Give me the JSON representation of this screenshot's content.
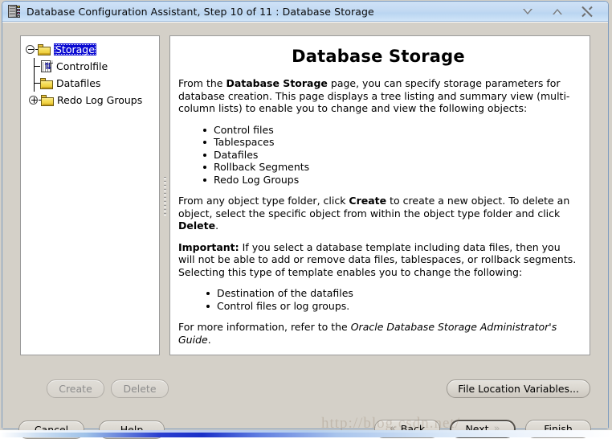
{
  "window": {
    "title": "Database Configuration Assistant, Step 10 of 11 : Database Storage",
    "icon": "database-icon",
    "controls": {
      "minimize": "minimize-icon",
      "maximize": "maximize-icon",
      "close": "close-icon"
    }
  },
  "tree": {
    "nodes": [
      {
        "label": "Storage",
        "icon": "folder-icon",
        "expanded": true,
        "selected": true,
        "level": 0
      },
      {
        "label": "Controlfile",
        "icon": "controlfile-icon",
        "expanded": null,
        "selected": false,
        "level": 1
      },
      {
        "label": "Datafiles",
        "icon": "folder-icon",
        "expanded": null,
        "selected": false,
        "level": 1
      },
      {
        "label": "Redo Log Groups",
        "icon": "folder-icon",
        "expanded": false,
        "selected": false,
        "level": 1
      }
    ]
  },
  "content": {
    "title": "Database Storage",
    "para1": {
      "before": "From the ",
      "bold": "Database Storage",
      "after": " page, you can specify storage parameters for database creation. This page displays a tree listing and summary view (multi-column lists) to enable you to change and view the following objects:"
    },
    "objects": [
      "Control files",
      "Tablespaces",
      "Datafiles",
      "Rollback Segments",
      "Redo Log Groups"
    ],
    "para2": {
      "t1": "From any object type folder, click ",
      "b1": "Create",
      "t2": " to create a new object. To delete an object, select the specific object from within the object type folder and click ",
      "b2": "Delete",
      "t3": "."
    },
    "para3": {
      "b1": "Important:",
      "t1": " If you select a database template including data files, then you will not be able to add or remove data files, tablespaces, or rollback segments. Selecting this type of template enables you to change the following:"
    },
    "changeable": [
      "Destination of the datafiles",
      "Control files or log groups."
    ],
    "para4": {
      "t1": "For more information, refer to the ",
      "i1": "Oracle Database Storage Administrator's Guide",
      "t2": "."
    }
  },
  "buttons": {
    "create": "Create",
    "delete": "Delete",
    "file_location_variables": "File Location Variables...",
    "cancel": "Cancel",
    "help": "Help",
    "back": "Back",
    "back_mnemonic": "B",
    "next": "Next",
    "next_mnemonic": "N",
    "finish": "Finish",
    "finish_mnemonic": "F",
    "back_chevron": "«",
    "next_chevron": "»"
  },
  "watermark": "http://blog.csdn.net/",
  "colors": {
    "titlebar": "#c3daf3",
    "window_bg": "#d4d0c8",
    "panel_bg": "#ffffff",
    "selection": "#0a0ad2",
    "folder": "#f5dc55"
  }
}
